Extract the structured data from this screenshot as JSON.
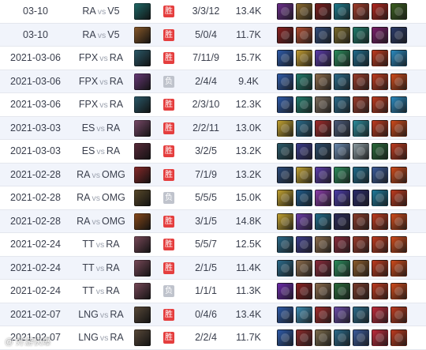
{
  "matches": [
    {
      "date": "03-10",
      "team1": "RA",
      "team2": "V5",
      "result": "胜",
      "kda": "3/3/12",
      "gold": "13.4K",
      "champ": "#1f6b6a",
      "items": [
        "#6a2d8a",
        "#8c6a2e",
        "#7b1c1c",
        "#1d7a8c",
        "#a33c2a",
        "#b3261e",
        "#3a5e1f"
      ]
    },
    {
      "date": "03-10",
      "team1": "RA",
      "team2": "V5",
      "result": "胜",
      "kda": "5/0/4",
      "gold": "11.7K",
      "champ": "#8a5a2a",
      "items": [
        "#8a1f1f",
        "#b04a2e",
        "#2f4a7a",
        "#7a6a2a",
        "#1e7a6a",
        "#7a1e6a",
        "#2a3a6a"
      ]
    },
    {
      "date": "2021-03-06",
      "team1": "FPX",
      "team2": "RA",
      "result": "胜",
      "kda": "7/11/9",
      "gold": "15.7K",
      "champ": "#2b5a6a",
      "items": [
        "#2d5aa8",
        "#c09a30",
        "#5a3aa8",
        "#2a8a5a",
        "#1e6a8a",
        "#c03a1e",
        "#2a8ac0"
      ]
    },
    {
      "date": "2021-03-06",
      "team1": "FPX",
      "team2": "RA",
      "result": "负",
      "kda": "2/4/4",
      "gold": "9.4K",
      "champ": "#6a3a7a",
      "items": [
        "#2d5aa8",
        "#1e7a6a",
        "#8a6a4a",
        "#2a6a8a",
        "#9a3a2a",
        "#c03a1e",
        "#d04a1a"
      ]
    },
    {
      "date": "2021-03-06",
      "team1": "FPX",
      "team2": "RA",
      "result": "胜",
      "kda": "2/3/10",
      "gold": "12.3K",
      "champ": "#2b5a6a",
      "items": [
        "#2d5aa8",
        "#1e7a6a",
        "#7a6a5a",
        "#2a6a8a",
        "#9a3a2a",
        "#c03a1e",
        "#2a8ac0"
      ]
    },
    {
      "date": "2021-03-03",
      "team1": "ES",
      "team2": "RA",
      "result": "胜",
      "kda": "2/2/11",
      "gold": "13.0K",
      "champ": "#7a4a6a",
      "items": [
        "#c0a030",
        "#2a6a8a",
        "#a02a2a",
        "#4a5a7a",
        "#2a8a9a",
        "#c03a1e",
        "#d04a1a"
      ]
    },
    {
      "date": "2021-03-03",
      "team1": "ES",
      "team2": "RA",
      "result": "胜",
      "kda": "3/2/5",
      "gold": "13.2K",
      "champ": "#5a2a3a",
      "items": [
        "#2a5a6a",
        "#3a3a8a",
        "#2a4a6a",
        "#6a8ab0",
        "#8a9aa0",
        "#2a6a3a",
        "#c03a1e"
      ]
    },
    {
      "date": "2021-02-28",
      "team1": "RA",
      "team2": "OMG",
      "result": "胜",
      "kda": "7/1/9",
      "gold": "13.2K",
      "champ": "#8a2a2a",
      "items": [
        "#2a4a7a",
        "#c0a030",
        "#5a3aa8",
        "#2a8a5a",
        "#1e6a8a",
        "#3a5a9a",
        "#d04a1a"
      ]
    },
    {
      "date": "2021-02-28",
      "team1": "RA",
      "team2": "OMG",
      "result": "负",
      "kda": "5/5/5",
      "gold": "15.0K",
      "champ": "#5a4a2a",
      "items": [
        "#c0a030",
        "#1e5a8a",
        "#8a3aa8",
        "#4a3aa8",
        "#2a2a6a",
        "#1e7a9a",
        "#c03a1e"
      ]
    },
    {
      "date": "2021-02-28",
      "team1": "RA",
      "team2": "OMG",
      "result": "胜",
      "kda": "3/1/5",
      "gold": "14.8K",
      "champ": "#8a4a1a",
      "items": [
        "#c0a030",
        "#6a3aa8",
        "#1e6a8a",
        "#2a2a5a",
        "#8a3a2a",
        "#c03a1e",
        "#d04a1a"
      ]
    },
    {
      "date": "2021-02-24",
      "team1": "TT",
      "team2": "RA",
      "result": "胜",
      "kda": "5/5/7",
      "gold": "12.5K",
      "champ": "#7a4a5a",
      "items": [
        "#2a6a8a",
        "#3a3a8a",
        "#8a6a4a",
        "#8a2a3a",
        "#9a3a2a",
        "#c03a1e",
        "#d04a1a"
      ]
    },
    {
      "date": "2021-02-24",
      "team1": "TT",
      "team2": "RA",
      "result": "胜",
      "kda": "2/1/5",
      "gold": "11.4K",
      "champ": "#7a4a5a",
      "items": [
        "#2a6a8a",
        "#8a6a4a",
        "#8a2a3a",
        "#2a8a5a",
        "#8a5a2a",
        "#c03a1e",
        "#d04a1a"
      ]
    },
    {
      "date": "2021-02-24",
      "team1": "TT",
      "team2": "RA",
      "result": "负",
      "kda": "1/1/1",
      "gold": "11.3K",
      "champ": "#7a4a5a",
      "items": [
        "#6a2aa8",
        "#8a1f1f",
        "#8a6a4a",
        "#2a6a3a",
        "#7a3a2a",
        "#c03a1e",
        "#d04a1a"
      ]
    },
    {
      "date": "2021-02-07",
      "team1": "LNG",
      "team2": "RA",
      "result": "胜",
      "kda": "0/4/6",
      "gold": "13.4K",
      "champ": "#5a4a3a",
      "items": [
        "#2d5aa8",
        "#3a8ab0",
        "#a02a2a",
        "#6a4aa8",
        "#2a6a8a",
        "#c02a3a",
        "#c03a1e"
      ]
    },
    {
      "date": "2021-02-07",
      "team1": "LNG",
      "team2": "RA",
      "result": "胜",
      "kda": "2/2/4",
      "gold": "11.7K",
      "champ": "#5a4a3a",
      "items": [
        "#2d5aa8",
        "#8a2a2a",
        "#7a6a4a",
        "#2a6a8a",
        "#3a5a9a",
        "#c02a3a",
        "#c03a1e"
      ]
    }
  ],
  "vs_label": "vs",
  "watermark": "@ 好游快爆"
}
